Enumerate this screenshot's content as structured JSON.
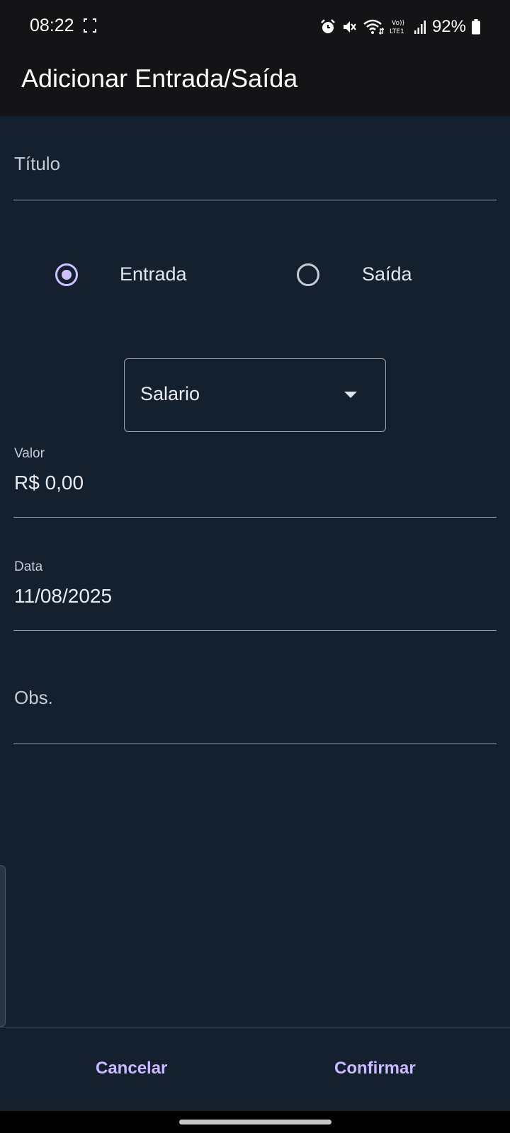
{
  "status_bar": {
    "time": "08:22",
    "battery": "92%",
    "icons": [
      "screenshot-bracket-icon",
      "alarm-icon",
      "mute-icon",
      "wifi-icon",
      "volte-icon",
      "signal-icon",
      "battery-icon"
    ]
  },
  "app_bar": {
    "title": "Adicionar Entrada/Saída"
  },
  "form": {
    "title_field": {
      "placeholder": "Título"
    },
    "type": {
      "options": [
        {
          "label": "Entrada",
          "selected": true
        },
        {
          "label": "Saída",
          "selected": false
        }
      ]
    },
    "category": {
      "selected": "Salario"
    },
    "amount": {
      "label": "Valor",
      "value": "R$ 0,00"
    },
    "date": {
      "label": "Data",
      "value": "11/08/2025"
    },
    "notes": {
      "placeholder": "Obs."
    }
  },
  "actions": {
    "cancel_label": "Cancelar",
    "confirm_label": "Confirmar"
  },
  "colors": {
    "background": "#15202f",
    "app_bar": "#141417",
    "accent": "#cfc0ff",
    "button_text": "#cbb9ff",
    "underline": "#9aa3b2"
  }
}
